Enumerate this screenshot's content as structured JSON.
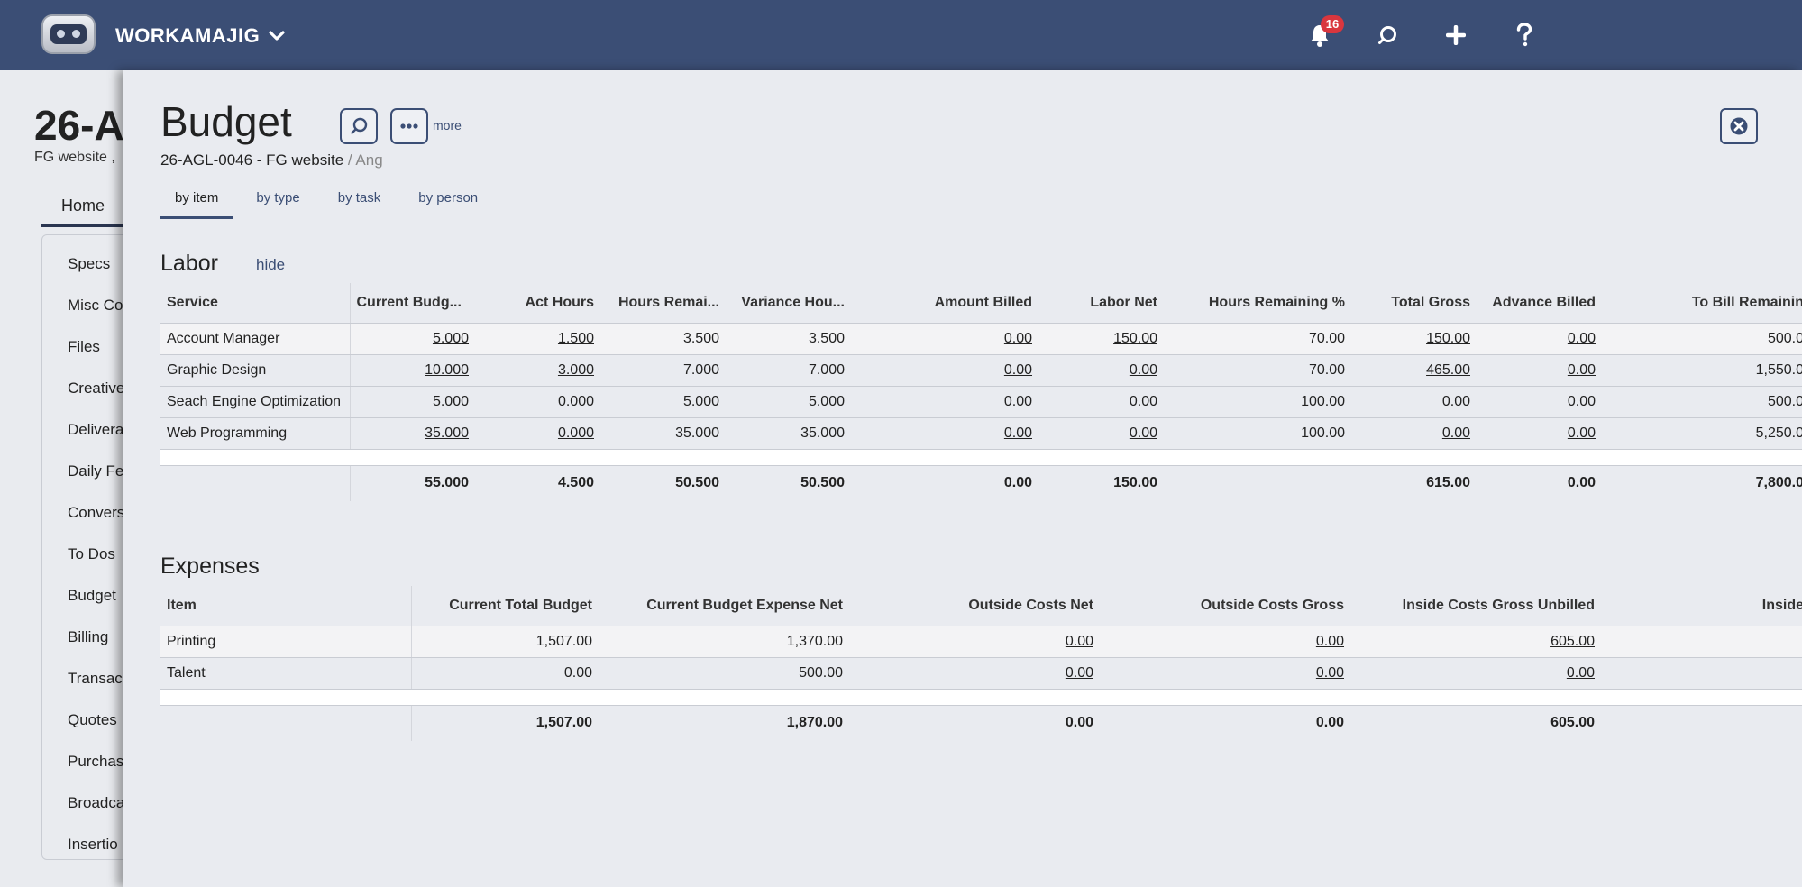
{
  "app": {
    "brand": "WORKAMAJIG",
    "notification_count": "16"
  },
  "background": {
    "title": "26-A",
    "subtitle": "FG website ,",
    "tab": "Home",
    "side_items": [
      "Specs",
      "Misc Co",
      "Files",
      "Creative",
      "Delivera",
      "Daily Fe",
      "Convers",
      "To Dos",
      "Budget",
      "Billing",
      "Transac",
      "Quotes",
      "Purchas",
      "Broadca",
      "Insertio"
    ]
  },
  "panel": {
    "title": "Budget",
    "more_label": "more",
    "breadcrumb_project": "26-AGL-0046 - FG website",
    "breadcrumb_sep": "/",
    "breadcrumb_rest": "Ang",
    "tabs": [
      "by item",
      "by type",
      "by task",
      "by person"
    ]
  },
  "labor": {
    "title": "Labor",
    "hide_label": "hide",
    "columns": [
      "Service",
      "Current Budg...",
      "Act Hours",
      "Hours Remai...",
      "Variance Hou...",
      "Amount Billed",
      "Labor Net",
      "Hours Remaining %",
      "Total Gross",
      "Advance Billed",
      "To Bill Remainin"
    ],
    "rows": [
      [
        "Account Manager",
        "5.000",
        "1.500",
        "3.500",
        "3.500",
        "0.00",
        "150.00",
        "70.00",
        "150.00",
        "0.00",
        "500.0"
      ],
      [
        "Graphic Design",
        "10.000",
        "3.000",
        "7.000",
        "7.000",
        "0.00",
        "0.00",
        "70.00",
        "465.00",
        "0.00",
        "1,550.0"
      ],
      [
        "Seach Engine Optimization",
        "5.000",
        "0.000",
        "5.000",
        "5.000",
        "0.00",
        "0.00",
        "100.00",
        "0.00",
        "0.00",
        "500.0"
      ],
      [
        "Web Programming",
        "35.000",
        "0.000",
        "35.000",
        "35.000",
        "0.00",
        "0.00",
        "100.00",
        "0.00",
        "0.00",
        "5,250.0"
      ]
    ],
    "totals": [
      "",
      "55.000",
      "4.500",
      "50.500",
      "50.500",
      "0.00",
      "150.00",
      "",
      "615.00",
      "0.00",
      "7,800.0"
    ]
  },
  "expenses": {
    "title": "Expenses",
    "columns": [
      "Item",
      "Current Total Budget",
      "Current Budget Expense Net",
      "Outside Costs Net",
      "Outside Costs Gross",
      "Inside Costs Gross Unbilled",
      "Inside"
    ],
    "rows": [
      [
        "Printing",
        "1,507.00",
        "1,370.00",
        "0.00",
        "0.00",
        "605.00",
        ""
      ],
      [
        "Talent",
        "0.00",
        "500.00",
        "0.00",
        "0.00",
        "0.00",
        ""
      ]
    ],
    "totals": [
      "",
      "1,507.00",
      "1,870.00",
      "0.00",
      "0.00",
      "605.00",
      ""
    ]
  }
}
